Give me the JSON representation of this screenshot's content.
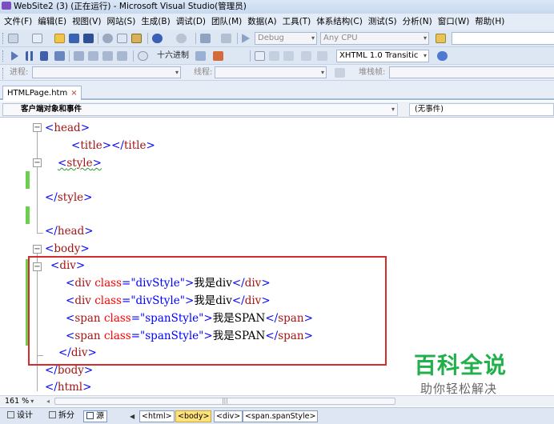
{
  "window": {
    "title": "WebSite2 (3) (正在运行) - Microsoft Visual Studio(管理员)"
  },
  "menu": [
    "文件(F)",
    "编辑(E)",
    "视图(V)",
    "网站(S)",
    "生成(B)",
    "调试(D)",
    "团队(M)",
    "数据(A)",
    "工具(T)",
    "体系结构(C)",
    "测试(S)",
    "分析(N)",
    "窗口(W)",
    "帮助(H)"
  ],
  "toolbar": {
    "config": "Debug",
    "platform": "Any CPU",
    "hex_label": "十六进制",
    "schema": "XHTML 1.0 Transitic",
    "process_label": "进程:",
    "thread_label": "线程:",
    "stackframe_label": "堆栈帧:"
  },
  "tab": {
    "label": "HTMLPage.htm",
    "close": "×"
  },
  "navbar": {
    "object": "客户端对象和事件",
    "event": "(无事件)"
  },
  "code": [
    {
      "n": 1,
      "parts": [
        [
          "br",
          "<"
        ],
        [
          "tg",
          "head"
        ],
        [
          "br",
          ">"
        ]
      ]
    },
    {
      "n": 2,
      "parts": [
        [
          "br",
          "<"
        ],
        [
          "tg",
          "title"
        ],
        [
          "br",
          "></"
        ],
        [
          "tg",
          "title"
        ],
        [
          "br",
          ">"
        ]
      ]
    },
    {
      "n": 3,
      "parts": [
        [
          "br",
          "<"
        ],
        [
          "tg",
          "style"
        ],
        [
          "br",
          ">"
        ]
      ]
    },
    {
      "n": 4,
      "parts": []
    },
    {
      "n": 5,
      "parts": [
        [
          "br",
          "</"
        ],
        [
          "tg",
          "style"
        ],
        [
          "br",
          ">"
        ]
      ]
    },
    {
      "n": 6,
      "parts": []
    },
    {
      "n": 7,
      "parts": [
        [
          "br",
          "</"
        ],
        [
          "tg",
          "head"
        ],
        [
          "br",
          ">"
        ]
      ]
    },
    {
      "n": 8,
      "parts": [
        [
          "br",
          "<"
        ],
        [
          "tg",
          "body"
        ],
        [
          "br",
          ">"
        ]
      ]
    },
    {
      "n": 9,
      "parts": [
        [
          "br",
          "<"
        ],
        [
          "tg",
          "div"
        ],
        [
          "br",
          ">"
        ]
      ]
    },
    {
      "n": 10,
      "parts": [
        [
          "br",
          "<"
        ],
        [
          "tg",
          "div"
        ],
        [
          "tx",
          " "
        ],
        [
          "at",
          "class"
        ],
        [
          "br",
          "="
        ],
        [
          "av",
          "\"divStyle\""
        ],
        [
          "br",
          ">"
        ],
        [
          "tx",
          "我是div"
        ],
        [
          "br",
          "</"
        ],
        [
          "tg",
          "div"
        ],
        [
          "br",
          ">"
        ]
      ]
    },
    {
      "n": 11,
      "parts": [
        [
          "br",
          "<"
        ],
        [
          "tg",
          "div"
        ],
        [
          "tx",
          " "
        ],
        [
          "at",
          "class"
        ],
        [
          "br",
          "="
        ],
        [
          "av",
          "\"divStyle\""
        ],
        [
          "br",
          ">"
        ],
        [
          "tx",
          "我是div"
        ],
        [
          "br",
          "</"
        ],
        [
          "tg",
          "div"
        ],
        [
          "br",
          ">"
        ]
      ]
    },
    {
      "n": 12,
      "parts": [
        [
          "br",
          "<"
        ],
        [
          "tg",
          "span"
        ],
        [
          "tx",
          " "
        ],
        [
          "at",
          "class"
        ],
        [
          "br",
          "="
        ],
        [
          "av",
          "\"spanStyle\""
        ],
        [
          "br",
          ">"
        ],
        [
          "tx",
          "我是SPAN"
        ],
        [
          "br",
          "</"
        ],
        [
          "tg",
          "span"
        ],
        [
          "br",
          ">"
        ]
      ]
    },
    {
      "n": 13,
      "parts": [
        [
          "br",
          "<"
        ],
        [
          "tg",
          "span"
        ],
        [
          "tx",
          " "
        ],
        [
          "at",
          "class"
        ],
        [
          "br",
          "="
        ],
        [
          "av",
          "\"spanStyle\""
        ],
        [
          "br",
          ">"
        ],
        [
          "tx",
          "我是SPAN"
        ],
        [
          "br",
          "</"
        ],
        [
          "tg",
          "span"
        ],
        [
          "br",
          ">"
        ]
      ]
    },
    {
      "n": 14,
      "parts": [
        [
          "br",
          "</"
        ],
        [
          "tg",
          "div"
        ],
        [
          "br",
          ">"
        ]
      ]
    },
    {
      "n": 15,
      "parts": [
        [
          "br",
          "</"
        ],
        [
          "tg",
          "body"
        ],
        [
          "br",
          ">"
        ]
      ]
    },
    {
      "n": 16,
      "parts": [
        [
          "br",
          "</"
        ],
        [
          "tg",
          "html"
        ],
        [
          "br",
          ">"
        ]
      ]
    }
  ],
  "zoom": "161 %",
  "views": [
    "设计",
    "拆分",
    "源"
  ],
  "breadcrumbs": [
    "<html>",
    "<body>",
    "<div>",
    "<span.spanStyle>"
  ],
  "watermark": {
    "brand": "百科全说",
    "tagline": "助你轻松解决"
  }
}
